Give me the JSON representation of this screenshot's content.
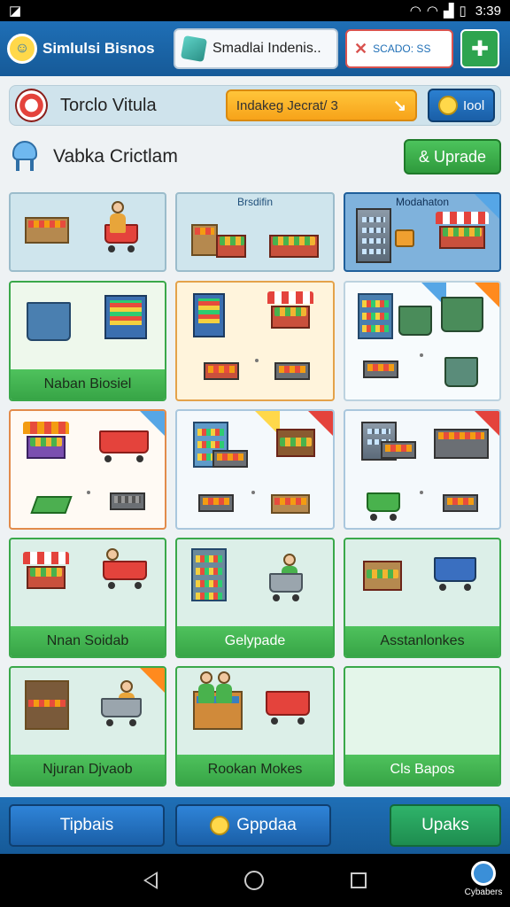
{
  "status": {
    "time": "3:39"
  },
  "header": {
    "app_title": "Simlulsi Bisnos",
    "active_tab": "Smadlai Indenis..",
    "second_tab": "SCADO: SS"
  },
  "subbar": {
    "title": "Torclo Vitula",
    "progress_text": "Indakeg Jecrat/ 3",
    "tool_label": "Iool"
  },
  "section": {
    "title": "Vabka Crictlam",
    "upgrade_label": "& Uprade"
  },
  "cards": {
    "r1c2_heading": "Brsdifin",
    "r1c3_heading": "Modahaton",
    "r2c1_label": "Naban Biosiel",
    "r4c1_label": "Nnan Soidab",
    "r4c2_label": "Gelypade",
    "r4c3_label": "Asstanlonkes",
    "r5c1_label": "Njuran Djvaob",
    "r5c2_label": "Rookan Mokes",
    "r5c3_label": "Cls Bapos"
  },
  "bottom": {
    "btn1": "Tipbais",
    "btn2": "Gppdaa",
    "btn3": "Upaks"
  },
  "system": {
    "corner_badge": "Cybabers"
  }
}
